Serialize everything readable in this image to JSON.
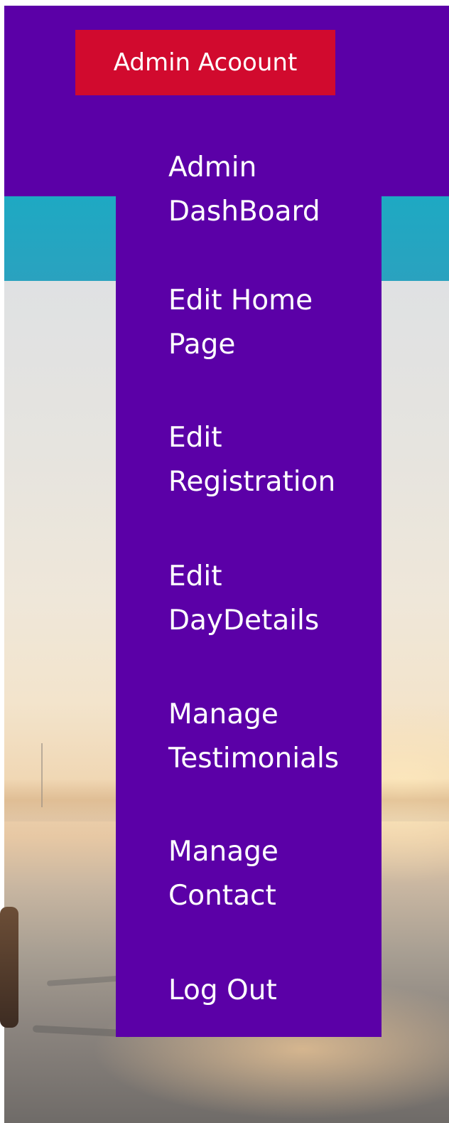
{
  "header": {
    "account_label": "Admin Acoount"
  },
  "dropdown": {
    "items": [
      {
        "label": "Admin DashBoard"
      },
      {
        "label": "Edit Home Page"
      },
      {
        "label": "Edit Registration"
      },
      {
        "label": "Edit DayDetails"
      },
      {
        "label": "Manage Testimonials"
      },
      {
        "label": "Manage Contact"
      },
      {
        "label": "Log Out"
      }
    ]
  },
  "colors": {
    "nav_purple": "#5b00a7",
    "account_red": "#d10a2e",
    "teal_band": "#1ea9c3",
    "menu_text": "#ffffff"
  }
}
